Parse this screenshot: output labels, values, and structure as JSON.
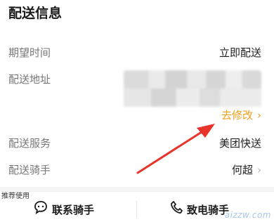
{
  "section": {
    "title": "配送信息"
  },
  "rows": {
    "expected_time": {
      "label": "期望时间",
      "value": "立即配送"
    },
    "address": {
      "label": "配送地址",
      "modify_label": "去修改"
    },
    "service": {
      "label": "配送服务",
      "value": "美团快送"
    },
    "rider": {
      "label": "配送骑手",
      "value": "何超"
    }
  },
  "bottom": {
    "recommend_tag": "推荐使用",
    "contact_rider_label": "联系骑手",
    "call_rider_label": "致电骑手"
  },
  "watermark": "aizzw.com",
  "colors": {
    "accent": "#f0a01c",
    "arrow": "#e8332a"
  },
  "icons": {
    "chevron": "›",
    "chat": "chat-icon",
    "phone": "phone-icon"
  }
}
